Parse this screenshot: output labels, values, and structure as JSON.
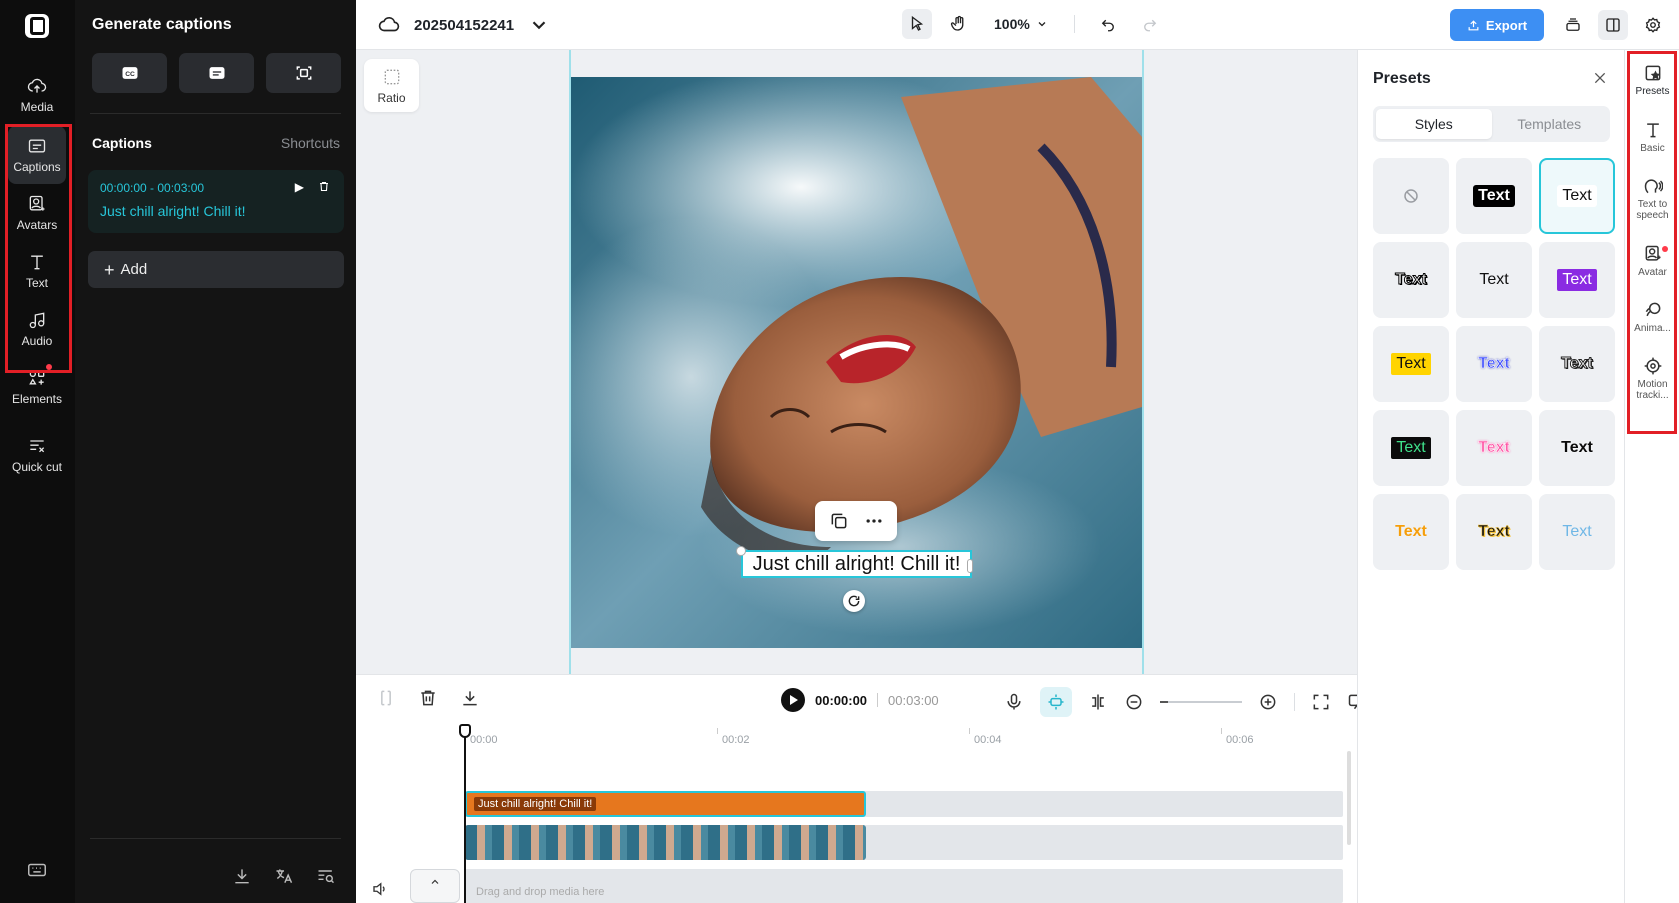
{
  "left_rail": {
    "items": [
      {
        "label": "Media",
        "icon": "cloud-upload-icon"
      },
      {
        "label": "Captions",
        "icon": "captions-icon"
      },
      {
        "label": "Avatars",
        "icon": "avatar-icon"
      },
      {
        "label": "Text",
        "icon": "text-icon"
      },
      {
        "label": "Audio",
        "icon": "music-note-icon"
      },
      {
        "label": "Elements",
        "icon": "elements-icon"
      },
      {
        "label": "Quick cut",
        "icon": "quick-cut-icon"
      }
    ]
  },
  "captions_panel": {
    "title": "Generate captions",
    "section_label": "Captions",
    "shortcuts_label": "Shortcuts",
    "items": [
      {
        "time": "00:00:00 - 00:03:00",
        "text": "Just chill alright! Chill it!"
      }
    ],
    "add_label": "Add"
  },
  "topbar": {
    "project_name": "202504152241",
    "zoom": "100%",
    "export_label": "Export"
  },
  "canvas": {
    "ratio_label": "Ratio",
    "caption_text": "Just chill alright! Chill it!"
  },
  "timeline": {
    "current_time": "00:00:00",
    "total_time": "00:03:00",
    "ruler": [
      "00:00",
      "00:02",
      "00:04",
      "00:06"
    ],
    "caption_clip_text": "Just chill alright! Chill it!",
    "drop_text": "Drag and drop media here"
  },
  "presets": {
    "title": "Presets",
    "tabs": [
      "Styles",
      "Templates"
    ],
    "cells": [
      {
        "label": "",
        "kind": "none"
      },
      {
        "label": "Text",
        "kind": "black-bg",
        "color": "#ffffff",
        "bg": "#000000"
      },
      {
        "label": "Text",
        "kind": "white-selected",
        "color": "#111111",
        "bg": "#ffffff"
      },
      {
        "label": "Text",
        "kind": "outline-white",
        "color": "#ffffff",
        "stroke": "#000000"
      },
      {
        "label": "Text",
        "kind": "plain",
        "color": "#111111"
      },
      {
        "label": "Text",
        "kind": "purple-bg",
        "color": "#ffffff",
        "bg": "#8a2be2"
      },
      {
        "label": "Text",
        "kind": "yellow-bg",
        "color": "#111111",
        "bg": "#ffd400"
      },
      {
        "label": "Text",
        "kind": "blue-outline",
        "color": "#3b4bff",
        "stroke": "#ffffff"
      },
      {
        "label": "Text",
        "kind": "white-outline-dark",
        "color": "#ffffff",
        "stroke": "#222222"
      },
      {
        "label": "Text",
        "kind": "green-on-black",
        "color": "#3fe08a",
        "bg": "#0b0b0b"
      },
      {
        "label": "Text",
        "kind": "pink-outline",
        "color": "#ff4fa3",
        "stroke": "#ffffff"
      },
      {
        "label": "Text",
        "kind": "black-outline-green",
        "color": "#0b0b0b",
        "stroke": "#ffffff"
      },
      {
        "label": "Text",
        "kind": "orange-gradient",
        "color": "#f59e0b",
        "stroke": "#ffffff"
      },
      {
        "label": "Text",
        "kind": "black-gold",
        "color": "#111111",
        "stroke": "#f4c542"
      },
      {
        "label": "Text",
        "kind": "light-blue",
        "color": "#6fb7e6"
      }
    ]
  },
  "right_strip": {
    "items": [
      {
        "label": "Presets",
        "icon": "presets-icon"
      },
      {
        "label": "Basic",
        "icon": "text-icon"
      },
      {
        "label": "Text to speech",
        "icon": "text-to-speech-icon"
      },
      {
        "label": "Avatar",
        "icon": "avatar-icon"
      },
      {
        "label": "Anima...",
        "icon": "animation-icon"
      },
      {
        "label": "Motion tracki...",
        "icon": "motion-tracking-icon"
      }
    ]
  },
  "colors": {
    "accent": "#27c6d9",
    "export": "#3d8ff3",
    "highlight_box": "#e21f26",
    "caption_clip": "#e6771e"
  }
}
